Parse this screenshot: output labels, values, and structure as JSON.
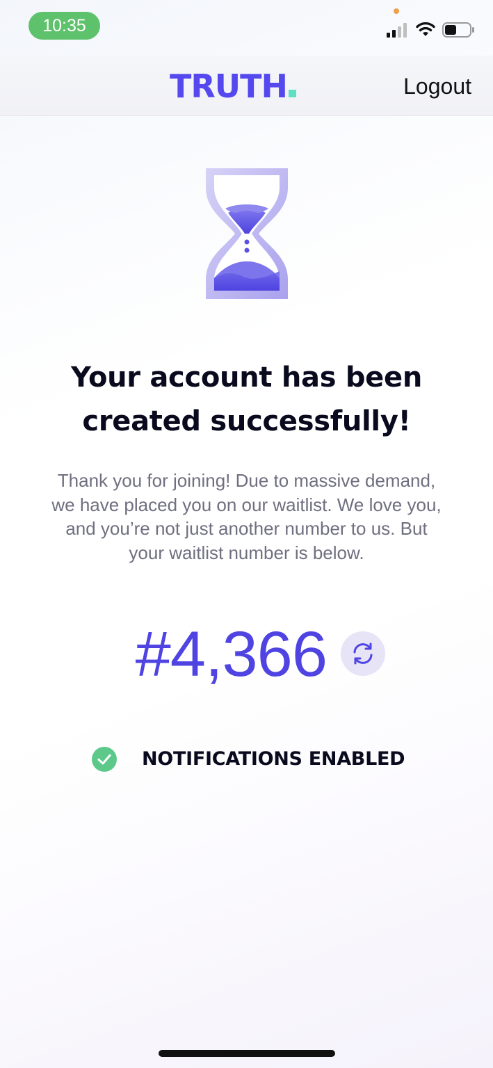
{
  "status_bar": {
    "time": "10:35",
    "icons": [
      "signal-icon",
      "wifi-icon",
      "battery-icon"
    ],
    "time_pill_color": "#5ec16b",
    "privacy_dot_color": "#f0a04b"
  },
  "header": {
    "logo": "TRUTH",
    "logout_label": "Logout",
    "brand_color": "#5448ee",
    "logo_accent_color": "#5fe0c3"
  },
  "main": {
    "illustration": "hourglass-icon",
    "headline": "Your account has been created successfully!",
    "body": "Thank you for joining! Due to massive demand, we have placed you on our waitlist. We love you, and you’re not just another number to us. But your waitlist number is below.",
    "waitlist_number": "#4,366",
    "refresh_icon": "refresh-icon",
    "notifications_label": "NOTIFICATIONS ENABLED",
    "notifications_icon": "check-circle-icon",
    "success_color": "#5cc98a",
    "number_color": "#4f44e2"
  }
}
